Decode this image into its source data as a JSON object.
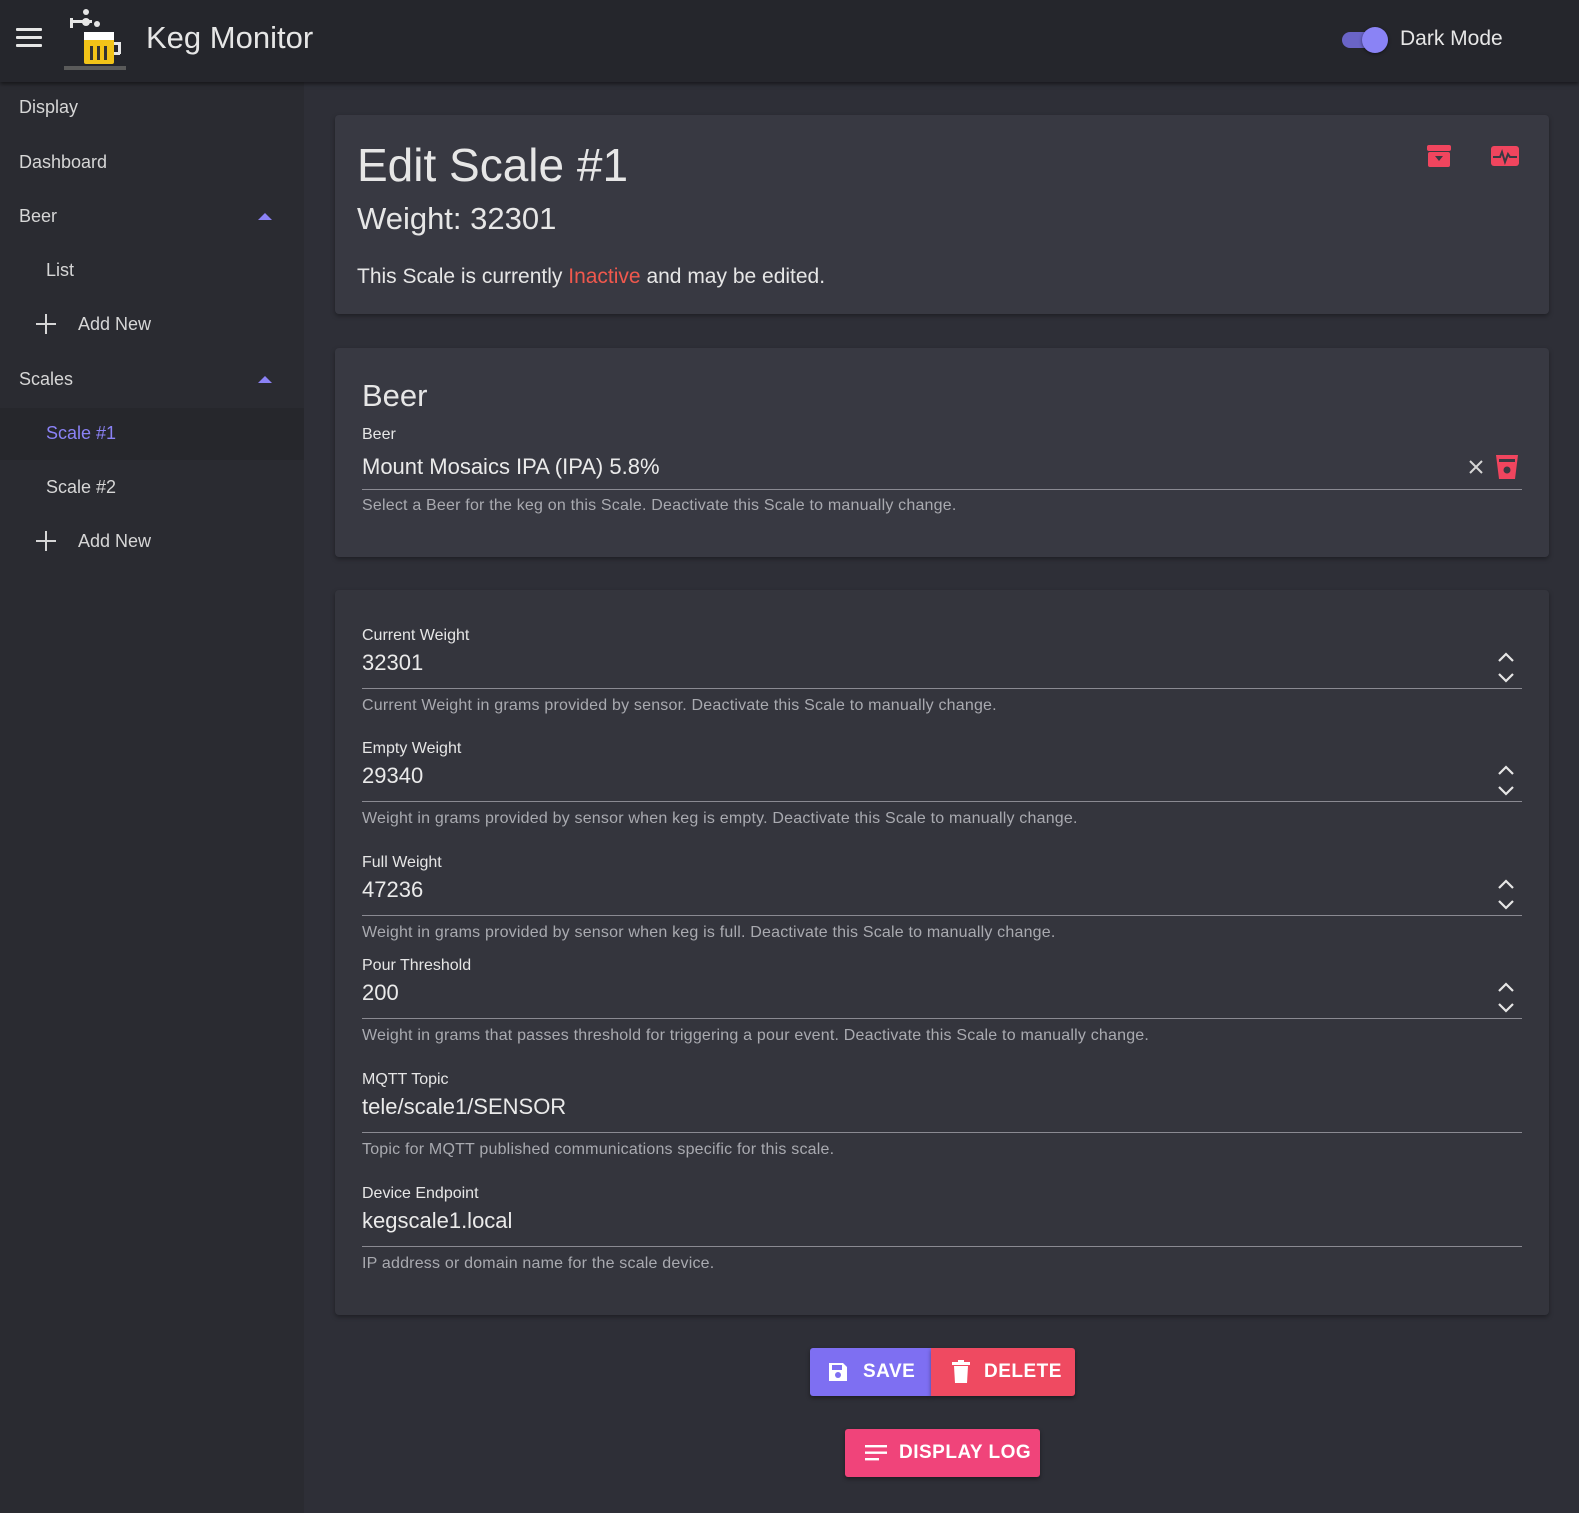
{
  "app": {
    "title": "Keg Monitor",
    "dark_mode_label": "Dark Mode",
    "dark_mode_on": true
  },
  "sidebar": {
    "display": "Display",
    "dashboard": "Dashboard",
    "beer": {
      "label": "Beer",
      "expanded": true,
      "items": [
        "List",
        "Add New"
      ]
    },
    "scales": {
      "label": "Scales",
      "expanded": true,
      "items": [
        "Scale #1",
        "Scale #2",
        "Add New"
      ],
      "active": "Scale #1"
    }
  },
  "header_card": {
    "title": "Edit Scale #1",
    "weight_label": "Weight: 32301",
    "status_prefix": "This Scale is currently ",
    "status_word": "Inactive",
    "status_suffix": " and may be edited."
  },
  "beer_card": {
    "title": "Beer",
    "field_label": "Beer",
    "value": "Mount Mosaics IPA (IPA) 5.8%",
    "hint": "Select a Beer for the keg on this Scale. Deactivate this Scale to manually change."
  },
  "fields": {
    "current_weight": {
      "label": "Current Weight",
      "value": "32301",
      "hint": "Current Weight in grams provided by sensor. Deactivate this Scale to manually change."
    },
    "empty_weight": {
      "label": "Empty Weight",
      "value": "29340",
      "hint": "Weight in grams provided by sensor when keg is empty. Deactivate this Scale to manually change."
    },
    "full_weight": {
      "label": "Full Weight",
      "value": "47236",
      "hint": "Weight in grams provided by sensor when keg is full. Deactivate this Scale to manually change."
    },
    "pour_threshold": {
      "label": "Pour Threshold",
      "value": "200",
      "hint": "Weight in grams that passes threshold for triggering a pour event. Deactivate this Scale to manually change."
    },
    "mqtt_topic": {
      "label": "MQTT Topic",
      "value": "tele/scale1/SENSOR",
      "hint": "Topic for MQTT published communications specific for this scale."
    },
    "device_endpoint": {
      "label": "Device Endpoint",
      "value": "kegscale1.local",
      "hint": "IP address or domain name for the scale device."
    }
  },
  "actions": {
    "save": "SAVE",
    "delete": "DELETE",
    "display_log": "DISPLAY LOG"
  },
  "colors": {
    "accent": "#7e6ff2",
    "danger": "#ef4a61",
    "pink": "#f0447a",
    "inactive": "#f0584d"
  }
}
